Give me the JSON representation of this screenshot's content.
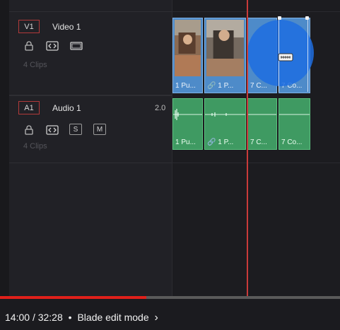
{
  "tracks": {
    "video": {
      "badge": "V1",
      "name": "Video 1",
      "clip_count": "4 Clips"
    },
    "audio": {
      "badge": "A1",
      "name": "Audio 1",
      "level": "2.0",
      "clip_count": "4 Clips",
      "solo_label": "S",
      "mute_label": "M"
    }
  },
  "video_clips": [
    {
      "label": "1 Pu..."
    },
    {
      "label": "1 P..."
    },
    {
      "label": "7 C..."
    },
    {
      "label": "7 Co..."
    }
  ],
  "audio_clips": [
    {
      "label": "1 Pu..."
    },
    {
      "label": "1 P..."
    },
    {
      "label": "7 C..."
    },
    {
      "label": "7 Co..."
    }
  ],
  "player": {
    "current_time": "14:00",
    "separator": "/",
    "duration": "32:28",
    "bullet": "•",
    "chapter": "Blade edit mode",
    "chapter_chevron": "›",
    "progress_fraction": 0.43
  },
  "colors": {
    "video_clip": "#4e8bc9",
    "audio_clip": "#3f9a62",
    "playhead": "#c93a3a",
    "progress": "#e0201a",
    "track_badge_border": "#b23a3a"
  },
  "icons": [
    "lock-icon",
    "auto-select-icon",
    "monitor-icon",
    "blade-icon",
    "link-icon"
  ]
}
